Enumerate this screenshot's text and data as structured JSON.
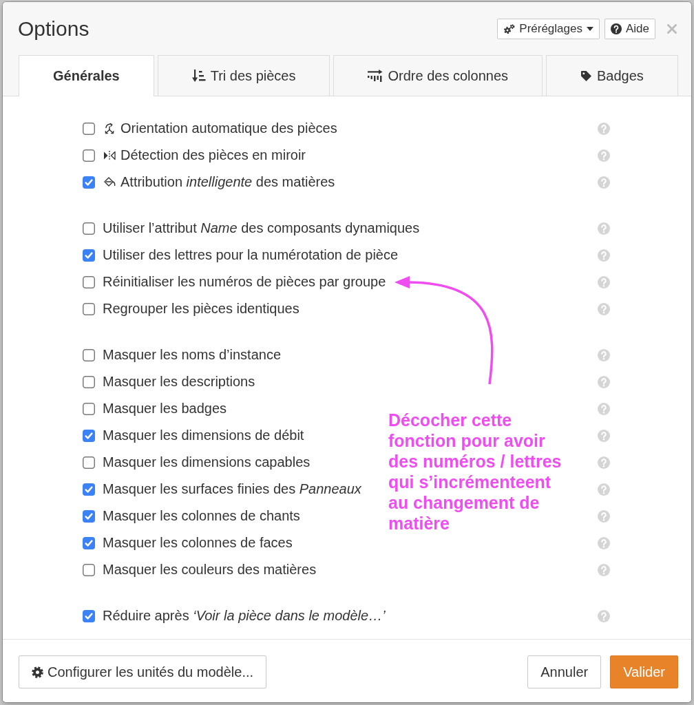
{
  "window": {
    "title": "Options"
  },
  "header_buttons": [
    {
      "kind": "presets",
      "label": "Préréglages"
    },
    {
      "kind": "help",
      "label": "Aide"
    }
  ],
  "tabs": [
    {
      "kind": "general",
      "label": "Générales",
      "selected": true
    },
    {
      "kind": "sort",
      "label": "Tri des pièces",
      "selected": false
    },
    {
      "kind": "columns",
      "label": "Ordre des colonnes",
      "selected": false
    },
    {
      "kind": "badges",
      "label": "Badges",
      "selected": false
    }
  ],
  "option_groups": [
    {
      "options": [
        {
          "kind": "orientation",
          "label": "Orientation automatique des pièces",
          "checked": false
        },
        {
          "kind": "mirror",
          "label": "Détection des pièces en miroir",
          "checked": false
        },
        {
          "kind": "material",
          "label": "Attribution *intelligente* des matières",
          "checked": true
        }
      ]
    },
    {
      "options": [
        {
          "kind": "plain",
          "label": "Utiliser l’attribut *Name* des composants dynamiques",
          "checked": false
        },
        {
          "kind": "plain",
          "label": "Utiliser des lettres pour la numérotation de pièce",
          "checked": true
        },
        {
          "kind": "plain",
          "label": "Réinitialiser les numéros de pièces par groupe",
          "checked": false
        },
        {
          "kind": "plain",
          "label": "Regrouper les pièces identiques",
          "checked": false
        }
      ]
    },
    {
      "options": [
        {
          "kind": "plain",
          "label": "Masquer les noms d’instance",
          "checked": false
        },
        {
          "kind": "plain",
          "label": "Masquer les descriptions",
          "checked": false
        },
        {
          "kind": "plain",
          "label": "Masquer les badges",
          "checked": false
        },
        {
          "kind": "plain",
          "label": "Masquer les dimensions de débit",
          "checked": true
        },
        {
          "kind": "plain",
          "label": "Masquer les dimensions capables",
          "checked": false
        },
        {
          "kind": "plain",
          "label": "Masquer les surfaces finies des *Panneaux*",
          "checked": true
        },
        {
          "kind": "plain",
          "label": "Masquer les colonnes de chants",
          "checked": true
        },
        {
          "kind": "plain",
          "label": "Masquer les colonnes de faces",
          "checked": true
        },
        {
          "kind": "plain",
          "label": "Masquer les couleurs des matières",
          "checked": false
        }
      ]
    },
    {
      "options": [
        {
          "kind": "plain",
          "label": "Réduire après *‘Voir la pièce dans le modèle…’*",
          "checked": true
        }
      ]
    }
  ],
  "annotation": {
    "text": "Décocher cette fonction pour avoir des numéros / lettres qui s’incrémenteent au changement de matière"
  },
  "footer_buttons": [
    {
      "kind": "units",
      "label": "Configurer les unités du modèle..."
    },
    {
      "kind": "cancel",
      "label": "Annuler"
    },
    {
      "kind": "submit",
      "label": "Valider"
    }
  ]
}
